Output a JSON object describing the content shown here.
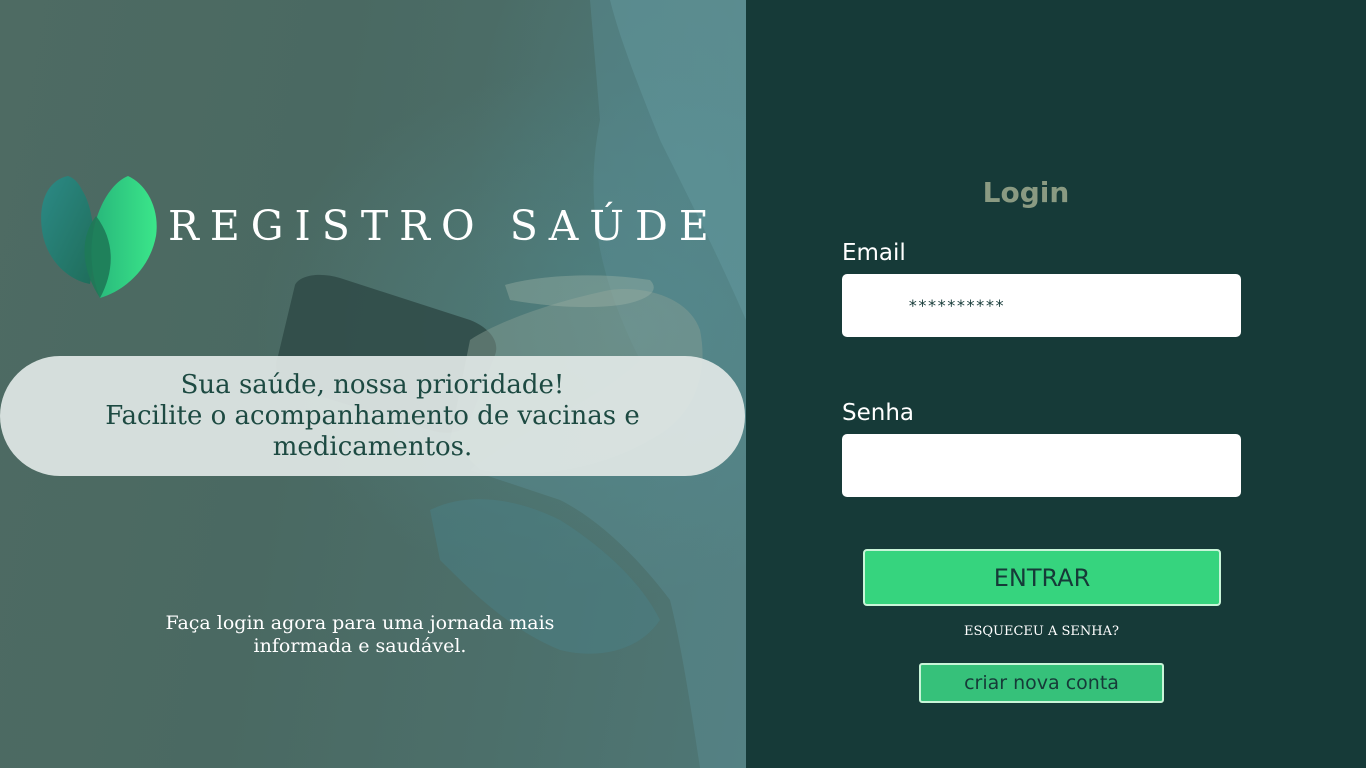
{
  "hero": {
    "brand_name": "REGISTRO SAÚDE",
    "tagline_line1": "Sua saúde, nossa prioridade!",
    "tagline_line2": "Facilite o acompanhamento de vacinas e medicamentos.",
    "cta_text": "Faça login agora para uma jornada mais informada e saudável."
  },
  "login": {
    "title": "Login",
    "email_label": "Email",
    "email_value": "**********",
    "password_label": "Senha",
    "password_value": "",
    "submit_label": "ENTRAR",
    "forgot_label": "ESQUECEU A SENHA?",
    "create_account_label": "criar nova conta"
  },
  "colors": {
    "panel_bg": "#163a38",
    "accent_green": "#36d47e",
    "title_muted": "#8a9a82",
    "pill_bg": "#e0e7e5"
  },
  "icons": {
    "logo": "heart-leaf-logo"
  }
}
